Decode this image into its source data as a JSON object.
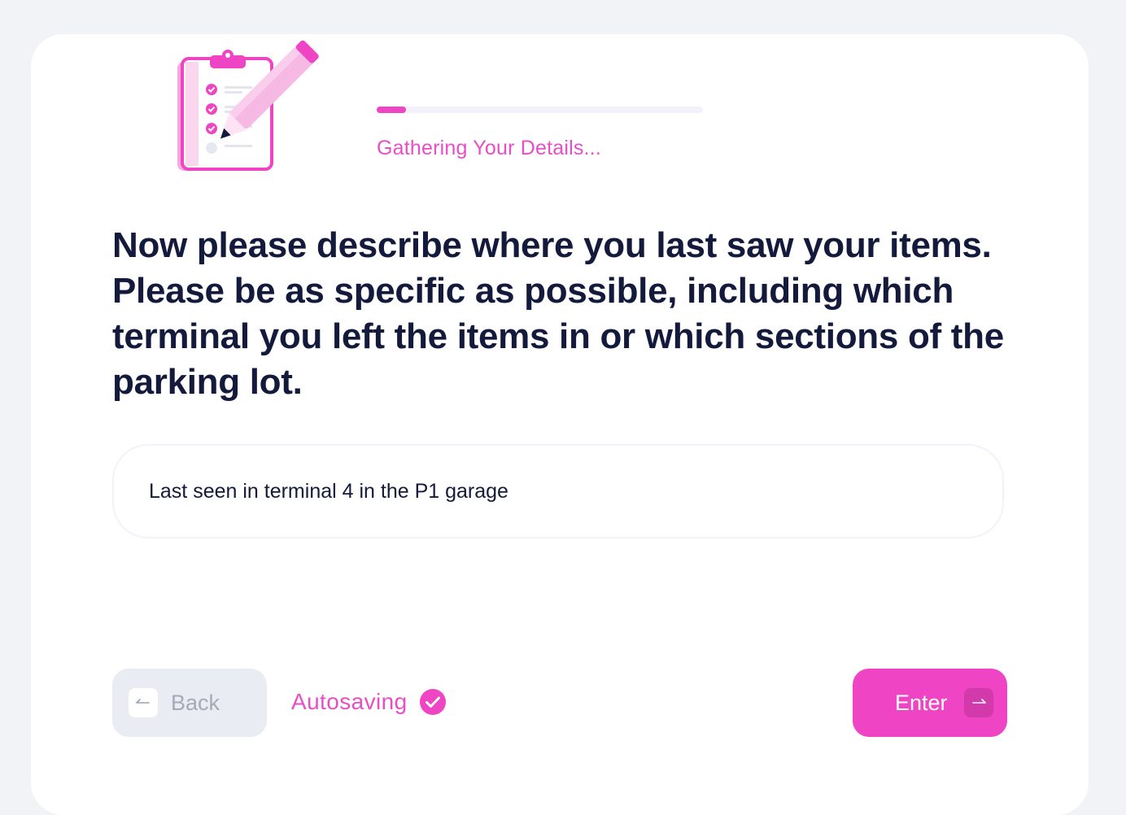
{
  "header": {
    "status_label": "Gathering Your Details...",
    "progress_percent": 9
  },
  "question": {
    "text": "Now please describe where you last saw your items. Please be as specific as possible, including which terminal you left the items in or which sections of the parking lot."
  },
  "answer": {
    "value": "Last seen in terminal 4 in the P1 garage"
  },
  "footer": {
    "back_label": "Back",
    "autosave_label": "Autosaving",
    "enter_label": "Enter"
  },
  "icons": {
    "illustration": "clipboard-pencil-icon",
    "back": "arrow-left-icon",
    "autosave": "check-circle-icon",
    "enter": "arrow-right-icon"
  },
  "colors": {
    "accent": "#ef44c4",
    "heading": "#141a3b",
    "background": "#f1f3f7"
  }
}
